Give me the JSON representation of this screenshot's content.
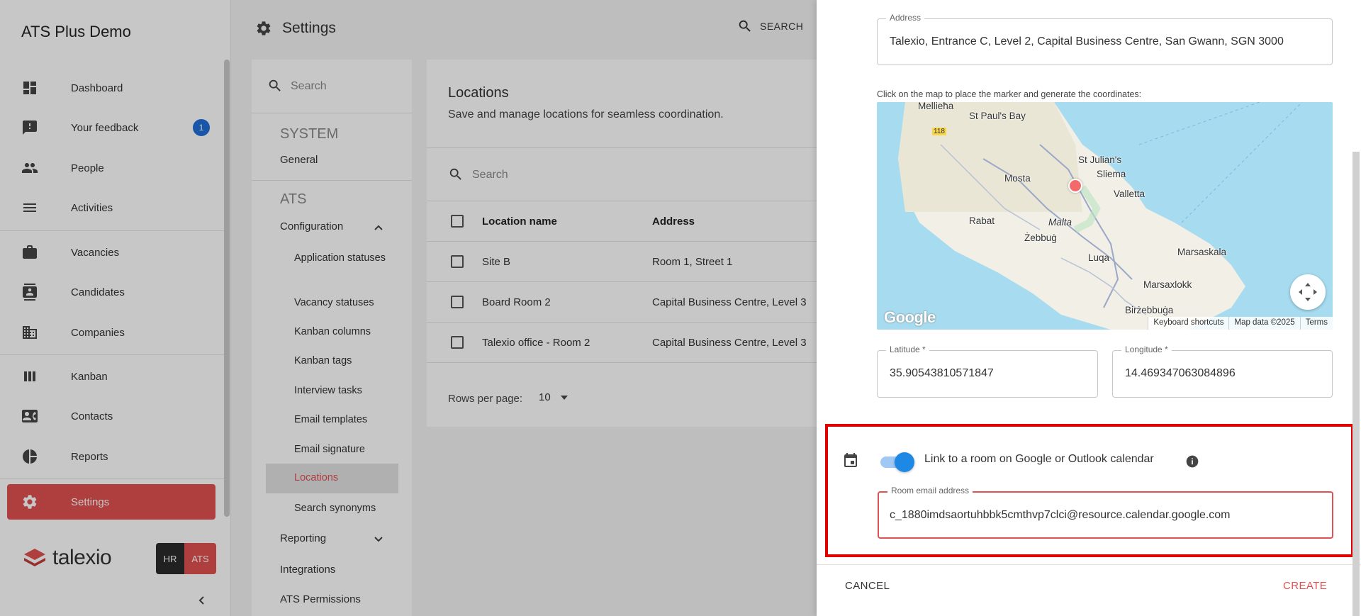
{
  "app": {
    "title": "ATS Plus Demo",
    "brand": "talexio",
    "module_hr": "HR",
    "module_ats": "ATS",
    "accent": "#e05151"
  },
  "nav": {
    "items": [
      {
        "label": "Dashboard",
        "icon": "dashboard-icon"
      },
      {
        "label": "Your feedback",
        "icon": "feedback-icon",
        "badge": "1"
      },
      {
        "label": "People",
        "icon": "people-icon"
      },
      {
        "label": "Activities",
        "icon": "activities-icon"
      },
      {
        "label": "Vacancies",
        "icon": "briefcase-icon"
      },
      {
        "label": "Candidates",
        "icon": "candidates-icon"
      },
      {
        "label": "Companies",
        "icon": "building-icon"
      },
      {
        "label": "Kanban",
        "icon": "kanban-icon"
      },
      {
        "label": "Contacts",
        "icon": "contacts-icon"
      },
      {
        "label": "Reports",
        "icon": "pie-chart-icon"
      },
      {
        "label": "Settings",
        "icon": "gear-icon",
        "active": true
      }
    ]
  },
  "topbar": {
    "title": "Settings",
    "search_label": "SEARCH"
  },
  "settings_nav": {
    "search_placeholder": "Search",
    "system_heading": "SYSTEM",
    "general": "General",
    "ats_heading": "ATS",
    "configuration": "Configuration",
    "children": [
      "Application statuses",
      "Vacancy statuses",
      "Kanban columns",
      "Kanban tags",
      "Interview tasks",
      "Email templates",
      "Email signature",
      "Locations",
      "Search synonyms"
    ],
    "reporting": "Reporting",
    "integrations": "Integrations",
    "ats_permissions": "ATS Permissions"
  },
  "locations": {
    "title": "Locations",
    "subtitle": "Save and manage locations for seamless coordination.",
    "search_placeholder": "Search",
    "columns": [
      "Location name",
      "Address"
    ],
    "rows": [
      {
        "name": "Site B",
        "address": "Room 1, Street 1"
      },
      {
        "name": "Board Room 2",
        "address": "Capital Business Centre, Level 3"
      },
      {
        "name": "Talexio office - Room 2",
        "address": "Capital Business Centre, Level 3"
      }
    ],
    "rows_per_page_label": "Rows per page:",
    "rows_per_page_value": "10"
  },
  "drawer": {
    "address_label": "Address",
    "address_value": "Talexio, Entrance C, Level 2, Capital Business Centre, San Gwann, SGN 3000",
    "map_hint": "Click on the map to place the marker and generate the coordinates:",
    "map": {
      "labels": [
        "Mellieħa",
        "St Paul's Bay",
        "118",
        "St Julian's",
        "Sliema",
        "Mosta",
        "Valletta",
        "Rabat",
        "Malta",
        "Żebbuġ",
        "Marsaskala",
        "Luqa",
        "Marsaxlokk",
        "Birżebbuġa"
      ],
      "google": "Google",
      "footer": [
        "Keyboard shortcuts",
        "Map data ©2025",
        "Terms"
      ]
    },
    "latitude_label": "Latitude *",
    "latitude_value": "35.90543810571847",
    "longitude_label": "Longitude *",
    "longitude_value": "14.469347063084896",
    "calendar_label": "Link to a room on Google or Outlook calendar",
    "calendar_toggle_on": true,
    "room_email_label": "Room email address",
    "room_email_value": "c_1880imdsaortuhbbk5cmthvp7clci@resource.calendar.google.com",
    "cancel": "CANCEL",
    "create": "CREATE"
  }
}
